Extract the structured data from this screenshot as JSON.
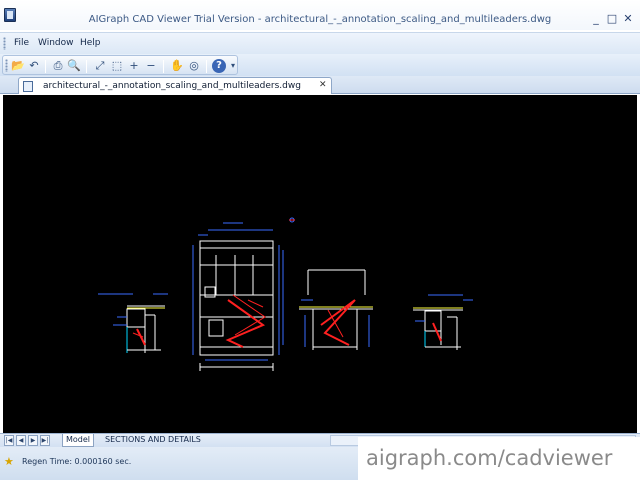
{
  "window": {
    "title": "AIGraph CAD Viewer Trial Version - architectural_-_annotation_scaling_and_multileaders.dwg",
    "minimize_glyph": "_",
    "maximize_glyph": "□",
    "close_glyph": "✕"
  },
  "menu": {
    "items": [
      {
        "label": "File"
      },
      {
        "label": "Window"
      },
      {
        "label": "Help"
      }
    ]
  },
  "toolbar": {
    "buttons": [
      {
        "icon": "open-folder-icon",
        "glyph": "📂"
      },
      {
        "icon": "save-icon",
        "glyph": "↶"
      },
      {
        "icon": "print-icon",
        "glyph": "⎙"
      },
      {
        "icon": "print-preview-icon",
        "glyph": "🔍"
      },
      {
        "icon": "zoom-extents-icon",
        "glyph": "⤢"
      },
      {
        "icon": "zoom-window-icon",
        "glyph": "⬚"
      },
      {
        "icon": "zoom-in-icon",
        "glyph": "+"
      },
      {
        "icon": "zoom-out-icon",
        "glyph": "−"
      },
      {
        "icon": "pan-icon",
        "glyph": "✋"
      },
      {
        "icon": "orbit-icon",
        "glyph": "◎"
      },
      {
        "icon": "help-icon",
        "glyph": "?"
      },
      {
        "icon": "toolbar-options-icon",
        "glyph": "▾"
      }
    ]
  },
  "document_tab": {
    "title": "architectural_-_annotation_scaling_and_multileaders.dwg",
    "close_glyph": "✕"
  },
  "layout_tabs": {
    "nav": [
      "|◀",
      "◀",
      "▶",
      "▶|"
    ],
    "tabs": [
      {
        "label": "Model",
        "active": true
      },
      {
        "label": "SECTIONS AND DETAILS",
        "active": false
      }
    ]
  },
  "status": {
    "regen_time": "Regen Time: 0.000160 sec.",
    "watermark": "aigraph.com/cadviewer"
  },
  "colors": {
    "canvas_background": "#000000",
    "drawing_white": "#ffffff",
    "drawing_red": "#ff2020",
    "drawing_blue": "#3a6bff",
    "drawing_cyan": "#00d7ff",
    "drawing_yellow": "#ffff40"
  }
}
